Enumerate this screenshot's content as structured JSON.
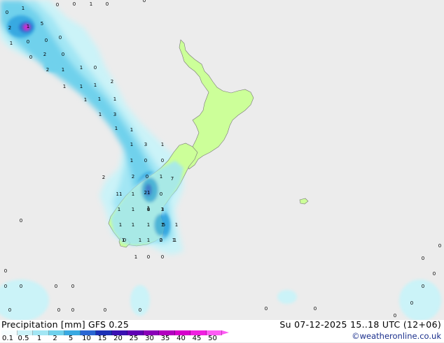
{
  "map": {
    "region": "New Zealand",
    "background_color": "#ececec",
    "land_color": "#ccff99",
    "precip_colors": [
      "#cbf3f8",
      "#a2e6f4",
      "#6fd1ec",
      "#39a9e1",
      "#2a66d2",
      "#1b2fb5",
      "#4a0fb0",
      "#a100b8",
      "#e000cc",
      "#ff33ee"
    ],
    "point_labels": [
      "1",
      "0",
      "0",
      "0",
      "1",
      "0",
      "0",
      "1",
      "5",
      "2",
      "0",
      "0",
      "0",
      "1",
      "0",
      "2",
      "0",
      "2",
      "1",
      "1",
      "0",
      "2",
      "1",
      "1",
      "1",
      "1",
      "1",
      "1",
      "1",
      "3",
      "1",
      "1",
      "1",
      "3",
      "1",
      "1",
      "0",
      "0",
      "2",
      "2",
      "0",
      "1",
      "7",
      "11",
      "1",
      "0",
      "1",
      "1",
      "1",
      "21",
      "1",
      "1",
      "1",
      "1",
      "1",
      "3",
      "1",
      "0",
      "1",
      "1",
      "1",
      "1",
      "5",
      "0",
      "0",
      "1",
      "1",
      "2",
      "1",
      "0",
      "0",
      "0",
      "0",
      "0",
      "0",
      "0",
      "0",
      "0",
      "0",
      "0",
      "0",
      "0",
      "0",
      "0",
      "0",
      "0",
      "0",
      "0",
      "0",
      "0"
    ]
  },
  "footer": {
    "legend_title": "Precipitation [mm]  GFS 0.25",
    "valid_time": "Su 07-12-2025 15..18 UTC (12+06)",
    "copyright": "©weatheronline.co.uk",
    "scale_labels": [
      "0.1",
      "0.5",
      "1",
      "2",
      "5",
      "10",
      "15",
      "20",
      "25",
      "30",
      "35",
      "40",
      "45",
      "50"
    ],
    "scale_colors": [
      "#f5fdfe",
      "#cbf3f8",
      "#a2e6f4",
      "#6fd1ec",
      "#39a9e1",
      "#2a66d2",
      "#1b2fb5",
      "#3a10b2",
      "#6000b4",
      "#8a00b8",
      "#b300c0",
      "#d600cc",
      "#f020e0",
      "#ff5cf5"
    ]
  }
}
